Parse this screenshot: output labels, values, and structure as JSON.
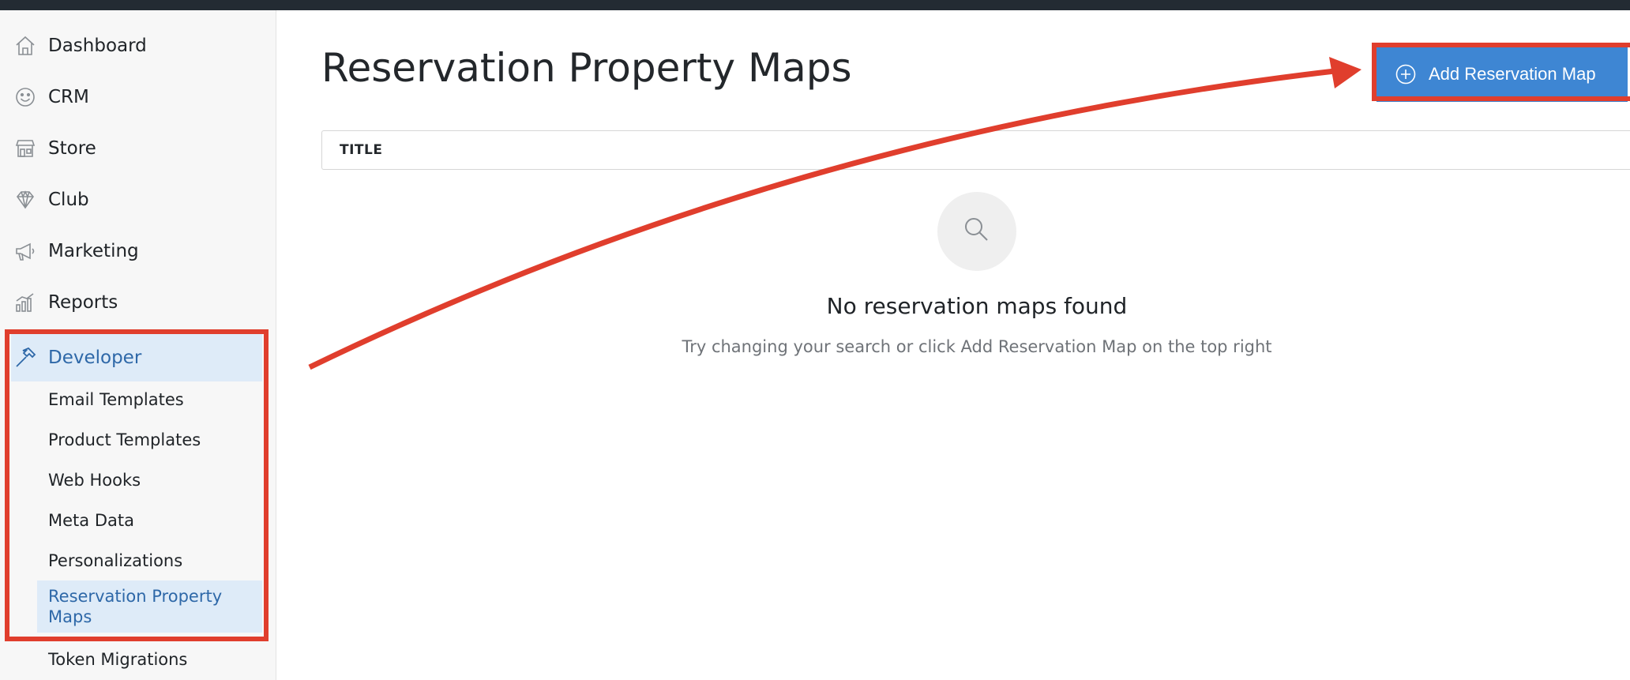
{
  "sidebar": {
    "items": [
      {
        "label": "Dashboard",
        "icon": "home-icon"
      },
      {
        "label": "CRM",
        "icon": "smiley-icon"
      },
      {
        "label": "Store",
        "icon": "storefront-icon"
      },
      {
        "label": "Club",
        "icon": "diamond-icon"
      },
      {
        "label": "Marketing",
        "icon": "megaphone-icon"
      },
      {
        "label": "Reports",
        "icon": "bar-chart-icon"
      },
      {
        "label": "Developer",
        "icon": "hammer-icon",
        "active": true
      }
    ],
    "developer_subitems": [
      {
        "label": "Email Templates"
      },
      {
        "label": "Product Templates"
      },
      {
        "label": "Web Hooks"
      },
      {
        "label": "Meta Data"
      },
      {
        "label": "Personalizations"
      },
      {
        "label": "Reservation Property Maps",
        "active": true
      },
      {
        "label": "Token Migrations"
      }
    ]
  },
  "main": {
    "title": "Reservation Property Maps",
    "add_button_label": "Add Reservation Map",
    "table": {
      "columns": [
        "TITLE"
      ]
    },
    "empty_state": {
      "title": "No reservation maps found",
      "subtitle": "Try changing your search or click Add Reservation Map on the top right"
    }
  },
  "colors": {
    "accent": "#3e86d3",
    "active_bg": "#deebf8",
    "active_text": "#2e68a8",
    "annotation": "#e03e2d",
    "topbar": "#232b33"
  }
}
